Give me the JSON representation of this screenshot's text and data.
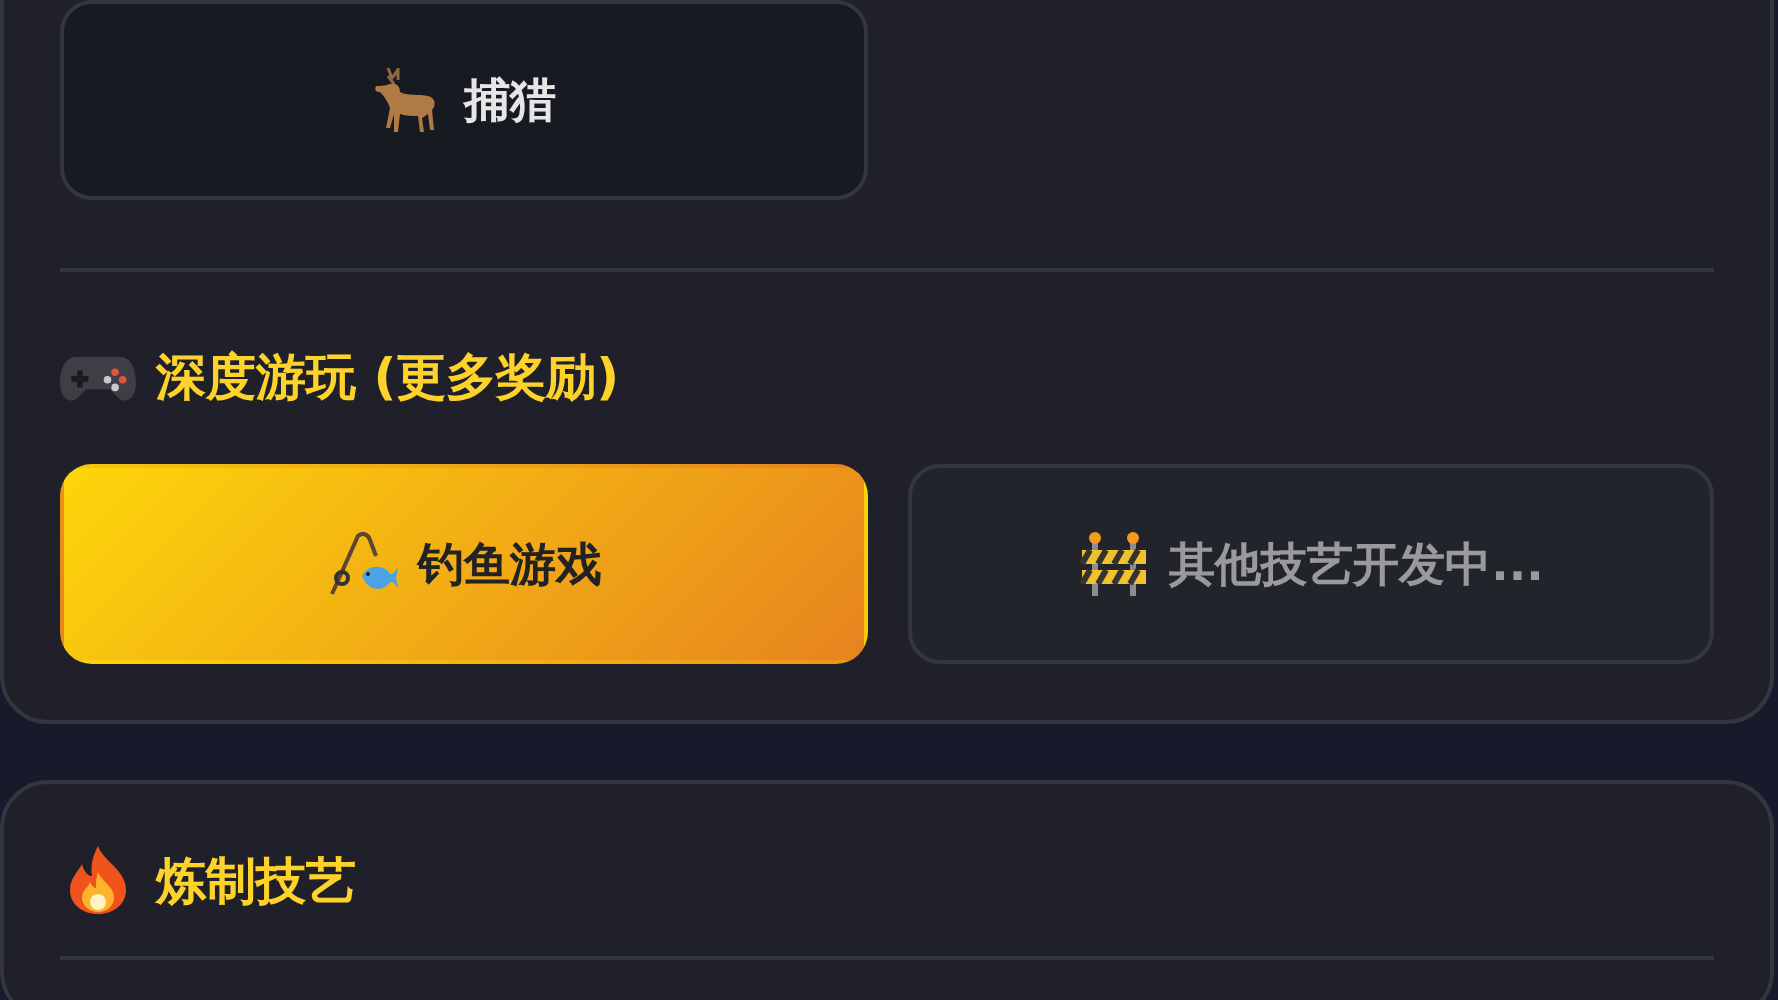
{
  "cards": [
    {
      "sections": [
        {
          "buttons": [
            {
              "label": "捕猎",
              "kind": "normal"
            }
          ]
        },
        {
          "title": "深度游玩 (更多奖励)",
          "buttons": [
            {
              "label": "钓鱼游戏",
              "kind": "featured"
            },
            {
              "label": "其他技艺开发中...",
              "kind": "disabled"
            }
          ]
        }
      ]
    },
    {
      "sections": [
        {
          "title": "炼制技艺"
        }
      ]
    }
  ]
}
